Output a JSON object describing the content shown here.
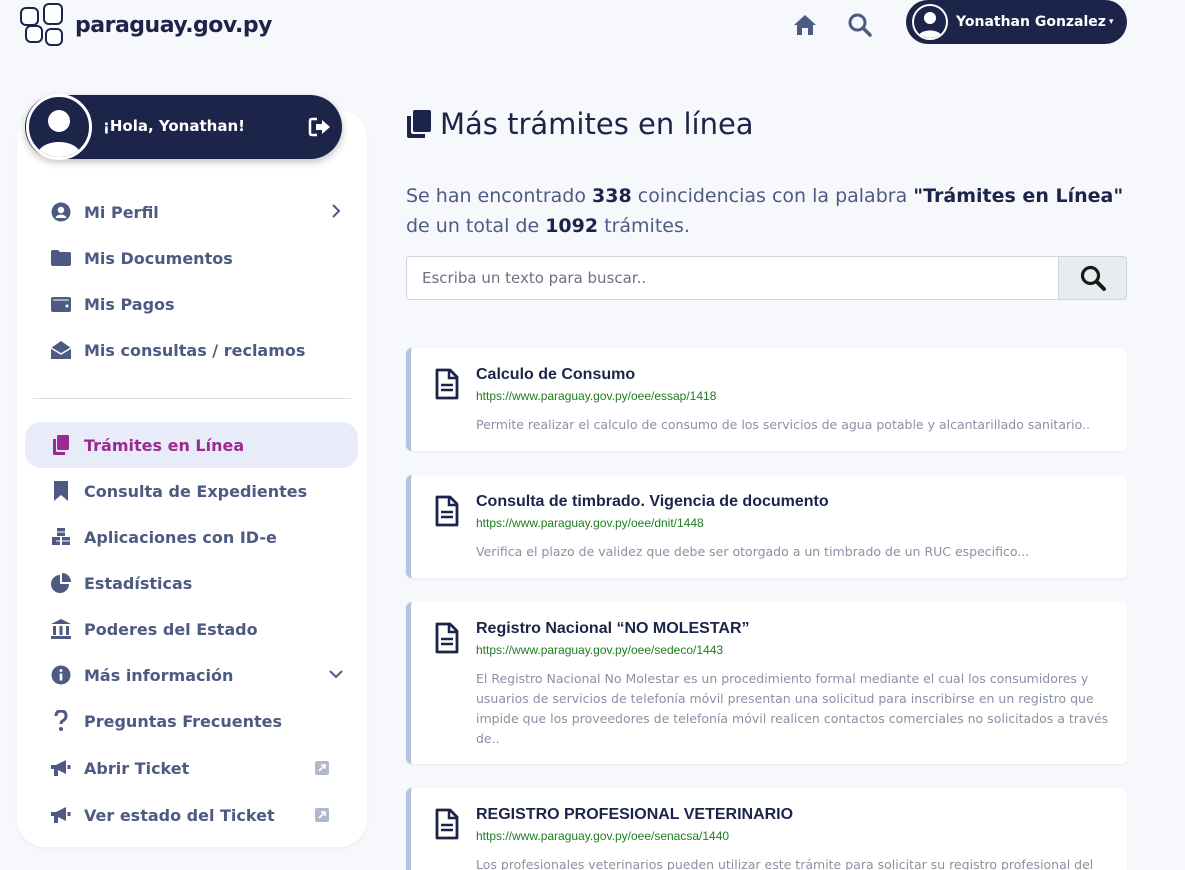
{
  "header": {
    "logo_text": "paraguay.gov.py",
    "user_name": "Yonathan Gonzalez"
  },
  "sidebar": {
    "greeting": "¡Hola, Yonathan!",
    "items": [
      {
        "label": "Mi Perfil",
        "icon": "user-circle-icon"
      },
      {
        "label": "Mis Documentos",
        "icon": "folder-icon"
      },
      {
        "label": "Mis Pagos",
        "icon": "wallet-icon"
      },
      {
        "label": "Mis consultas / reclamos",
        "icon": "envelope-open-icon"
      },
      {
        "label": "Trámites en Línea",
        "icon": "copy-icon"
      },
      {
        "label": "Consulta de Expedientes",
        "icon": "bookmark-icon"
      },
      {
        "label": "Aplicaciones con ID-e",
        "icon": "cubes-icon"
      },
      {
        "label": "Estadísticas",
        "icon": "pie-chart-icon"
      },
      {
        "label": "Poderes del Estado",
        "icon": "bank-icon"
      },
      {
        "label": "Más información",
        "icon": "info-circle-icon"
      },
      {
        "label": "Preguntas Frecuentes",
        "icon": "question-icon"
      },
      {
        "label": "Abrir Ticket",
        "icon": "megaphone-icon"
      },
      {
        "label": "Ver estado del Ticket",
        "icon": "megaphone-icon"
      }
    ]
  },
  "main": {
    "title": "Más trámites en línea",
    "summary": {
      "p1": "Se han encontrado ",
      "count": "338",
      "p2": " coincidencias con la palabra ",
      "keyword": "\"Trámites en Línea\"",
      "p3": " de un total de ",
      "total": "1092",
      "p4": " trámites."
    },
    "search_placeholder": "Escriba un texto para buscar..",
    "results": [
      {
        "title": "Calculo de Consumo",
        "url": "https://www.paraguay.gov.py/oee/essap/1418",
        "desc": "Permite realizar el calculo de consumo de los servicios de agua potable y alcantarillado sanitario.."
      },
      {
        "title": "Consulta de timbrado. Vigencia de documento",
        "url": "https://www.paraguay.gov.py/oee/dnit/1448",
        "desc": "Verifica el plazo de validez que debe ser otorgado a un timbrado de un RUC especifico..."
      },
      {
        "title": "Registro Nacional “NO MOLESTAR”",
        "url": "https://www.paraguay.gov.py/oee/sedeco/1443",
        "desc": "El Registro Nacional No Molestar es un procedimiento formal mediante el cual los consumidores y usuarios de servicios de telefonía móvil presentan una solicitud para inscribirse en un registro que impide que los proveedores de telefonía móvil realicen contactos comerciales no solicitados a través de.."
      },
      {
        "title": "REGISTRO PROFESIONAL VETERINARIO",
        "url": "https://www.paraguay.gov.py/oee/senacsa/1440",
        "desc": "Los profesionales veterinarios pueden utilizar este trámite para solicitar su registro profesional del"
      }
    ]
  },
  "colors": {
    "navy": "#1c2449",
    "active": "#9b2a8e",
    "link_green": "#1e7d1e",
    "card_border": "#b5c3e2"
  }
}
